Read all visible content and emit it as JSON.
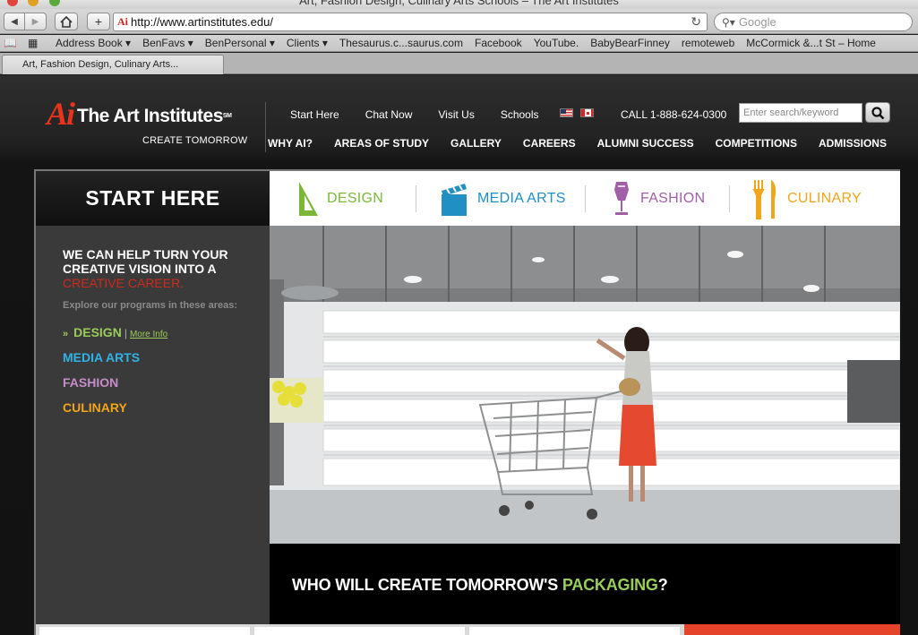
{
  "browser": {
    "window_title": "Art, Fashion Design, Culinary Arts Schools – The Art Institutes",
    "url": "http://www.artinstitutes.edu/",
    "favicon_text": "Ai",
    "search_placeholder": "Google",
    "bookmarks": [
      "Address Book ▾",
      "BenFavs ▾",
      "BenPersonal ▾",
      "Clients ▾",
      "Thesaurus.c...saurus.com",
      "Facebook",
      "YouTube.",
      "BabyBearFinney",
      "remoteweb",
      "McCormick &...t St – Home"
    ],
    "tab_title": "Art, Fashion Design, Culinary Arts..."
  },
  "site": {
    "logo_mark": "Ai",
    "logo_name": "The Art Institutes",
    "logo_sm": "SM",
    "tagline": "CREATE TOMORROW",
    "top_links": [
      "Start Here",
      "Chat Now",
      "Visit Us",
      "Schools"
    ],
    "phone": "CALL 1-888-624-0300",
    "search_placeholder": "Enter search/keyword",
    "main_nav": [
      "WHY AI?",
      "AREAS OF STUDY",
      "GALLERY",
      "CAREERS",
      "ALUMNI SUCCESS",
      "COMPETITIONS",
      "ADMISSIONS"
    ]
  },
  "sidebar": {
    "header": "START HERE",
    "headline_line1": "WE CAN HELP TURN YOUR",
    "headline_line2": "CREATIVE VISION INTO A",
    "headline_red": "CREATIVE CAREER.",
    "explore": "Explore our programs in these areas:",
    "design": "DESIGN",
    "design_sep": "|",
    "more_info": "More Info",
    "media_arts": "MEDIA ARTS",
    "fashion": "FASHION",
    "culinary": "CULINARY"
  },
  "programs": [
    {
      "label": "DESIGN",
      "color": "#7bb83a"
    },
    {
      "label": "MEDIA ARTS",
      "color": "#1f8fc4"
    },
    {
      "label": "FASHION",
      "color": "#a05fa6"
    },
    {
      "label": "CULINARY",
      "color": "#f1a51a"
    }
  ],
  "cta": {
    "prefix": "WHO WILL CREATE TOMORROW'S ",
    "highlight": "PACKAGING",
    "suffix": "?"
  },
  "colors": {
    "brand_red": "#e8341c",
    "design_green": "#9acc5a",
    "media_blue": "#31b2e6",
    "fashion_purple": "#c78ccb",
    "culinary_orange": "#f1a51a"
  }
}
